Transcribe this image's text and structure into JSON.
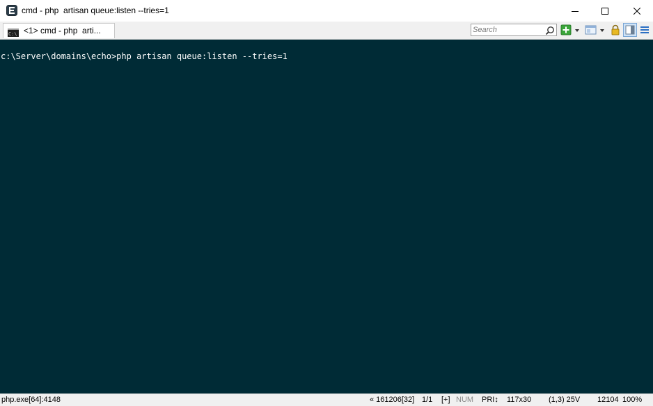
{
  "window": {
    "title": "cmd - php  artisan queue:listen --tries=1"
  },
  "tabs": [
    {
      "label": "<1> cmd - php  arti..."
    }
  ],
  "search": {
    "placeholder": "Search"
  },
  "console": {
    "lines": [
      "c:\\Server\\domains\\echo>php artisan queue:listen --tries=1"
    ],
    "background_color": "#002b36",
    "text_color": "#ffffff"
  },
  "statusbar": {
    "process": "php.exe[64]:4148",
    "build": "« 161206[32]",
    "console_index": "1/1",
    "insert_mode": "[+]",
    "num": "NUM",
    "priority": "PRI↕",
    "size": "117x30",
    "cursor": "(1,3) 25V",
    "pid": "12104",
    "zoom": "100%"
  },
  "icons": {
    "app": "conemu-app-icon",
    "tab": "cmd-console-icon",
    "search": "search-icon",
    "new_console": "plus-icon",
    "layout": "window-layout-icon",
    "lock": "lock-icon",
    "panel": "panel-toggle-icon",
    "menu": "hamburger-menu-icon"
  }
}
